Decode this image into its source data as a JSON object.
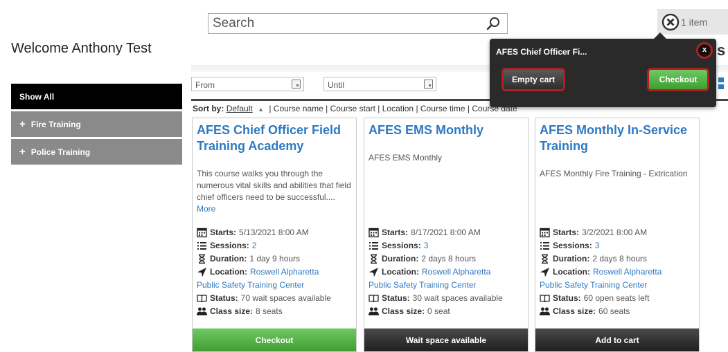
{
  "search": {
    "placeholder": "Search"
  },
  "cart": {
    "count_label": "1 item"
  },
  "welcome": "Welcome Anthony Test",
  "title_fragment": "s",
  "sidebar": {
    "items": [
      {
        "label": "Show All",
        "prefix": ""
      },
      {
        "label": "Fire Training",
        "prefix": "+"
      },
      {
        "label": "Police Training",
        "prefix": "+"
      }
    ]
  },
  "filters": {
    "from_placeholder": "From",
    "until_placeholder": "Until"
  },
  "sort": {
    "label": "Sort by:",
    "default": "Default",
    "arrow": "▲",
    "options": "| Course name | Course start | Location | Course time | Course date"
  },
  "courses": [
    {
      "title": "AFES Chief Officer Field Training Academy",
      "description": "This course walks you through the numerous vital skills and abilities that field chief officers need to be successful....",
      "more": "More",
      "starts_label": "Starts:",
      "starts": "5/13/2021 8:00 AM",
      "sessions_label": "Sessions:",
      "sessions": "2",
      "duration_label": "Duration:",
      "duration": "1 day 9 hours",
      "location_label": "Location:",
      "location_1": "Roswell Alpharetta",
      "location_2": "Public Safety Training Center",
      "status_label": "Status:",
      "status": "70 wait spaces available",
      "size_label": "Class size:",
      "size": "8 seats",
      "button": "Checkout"
    },
    {
      "title": "AFES EMS Monthly",
      "description": "AFES EMS Monthly",
      "more": "",
      "starts_label": "Starts:",
      "starts": "8/17/2021 8:00 AM",
      "sessions_label": "Sessions:",
      "sessions": "3",
      "duration_label": "Duration:",
      "duration": "2 days 8 hours",
      "location_label": "Location:",
      "location_1": "Roswell Alpharetta",
      "location_2": "Public Safety Training Center",
      "status_label": "Status:",
      "status": "30 wait spaces available",
      "size_label": "Class size:",
      "size": "0 seat",
      "button": "Wait space available"
    },
    {
      "title": "AFES Monthly In-Service Training",
      "description": "AFES Monthly Fire Training - Extrication",
      "more": "",
      "starts_label": "Starts:",
      "starts": "3/2/2021 8:00 AM",
      "sessions_label": "Sessions:",
      "sessions": "3",
      "duration_label": "Duration:",
      "duration": "2 days 8 hours",
      "location_label": "Location:",
      "location_1": "Roswell Alpharetta",
      "location_2": "Public Safety Training Center",
      "status_label": "Status:",
      "status": "60 open seats left",
      "size_label": "Class size:",
      "size": "60 seats",
      "button": "Add to cart"
    }
  ],
  "popup": {
    "title": "AFES Chief Officer Fi...",
    "close": "x",
    "empty_cart": "Empty cart",
    "checkout": "Checkout"
  },
  "colors": {
    "link_blue": "#2e79c2",
    "green": "#3f9e32",
    "highlight_red": "#b01f24",
    "dark": "#2a2a2a"
  }
}
